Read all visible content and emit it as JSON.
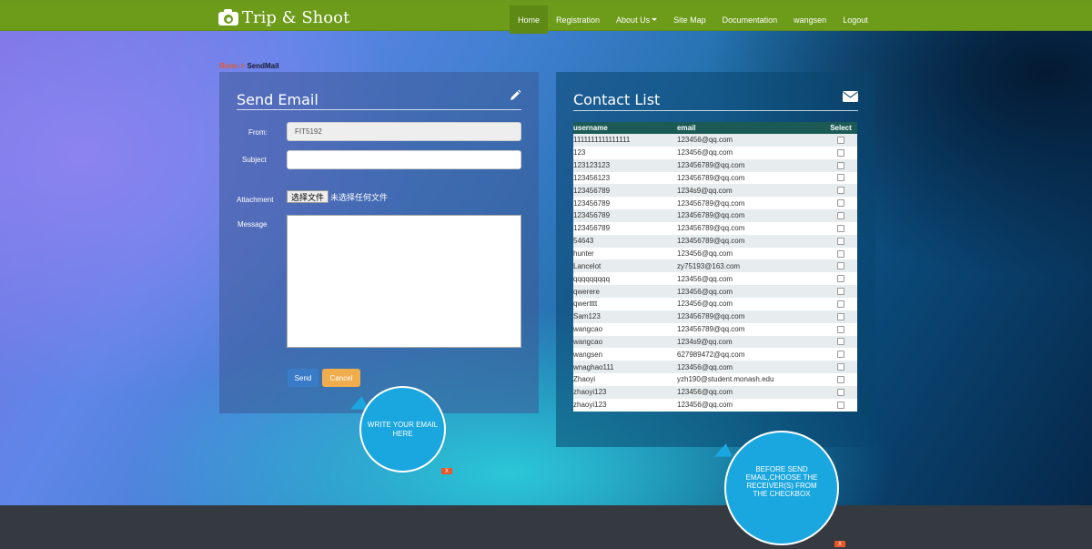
{
  "brand": {
    "title": "Trip & Shoot",
    "icon": "camera-icon"
  },
  "nav": {
    "items": [
      {
        "label": "Home",
        "active": true
      },
      {
        "label": "Registration"
      },
      {
        "label": "About Us",
        "dropdown": true
      },
      {
        "label": "Site Map"
      },
      {
        "label": "Documentation"
      },
      {
        "label": "wangsen"
      },
      {
        "label": "Logout"
      }
    ]
  },
  "breadcrumb": {
    "home": "Root",
    "arrow": "-->",
    "current": "SendMail"
  },
  "send_email": {
    "title": "Send Email",
    "icon": "pencil-icon",
    "from_label": "From:",
    "from_value": "FIT5192",
    "subject_label": "Subject",
    "subject_value": "",
    "attachment_label": "Attachment",
    "file_button": "选择文件",
    "file_status": "未选择任何文件",
    "message_label": "Message",
    "send_button": "Send",
    "cancel_button": "Cancel"
  },
  "contact_list": {
    "title": "Contact List",
    "icon": "envelope-icon",
    "headers": [
      "username",
      "email",
      "Select"
    ],
    "rows": [
      [
        "1111111111111111",
        "123456@qq.com"
      ],
      [
        "123",
        "123456@qq.com"
      ],
      [
        "123123123",
        "123456789@qq.com"
      ],
      [
        "123456123",
        "123456789@qq.com"
      ],
      [
        "123456789",
        "1234s9@qq.com"
      ],
      [
        "123456789",
        "123456789@qq.com"
      ],
      [
        "123456789",
        "123456789@qq.com"
      ],
      [
        "123456789",
        "123456789@qq.com"
      ],
      [
        "54643",
        "123456789@qq.com"
      ],
      [
        "hunter",
        "123456@qq.com"
      ],
      [
        "Lancelot",
        "zy75193@163.com"
      ],
      [
        "qqqqqqqqq",
        "123456@qq.com"
      ],
      [
        "qwerere",
        "123456@qq.com"
      ],
      [
        "qwertttt",
        "123456@qq.com"
      ],
      [
        "Sam123",
        "123456789@qq.com"
      ],
      [
        "wangcao",
        "123456789@qq.com"
      ],
      [
        "wangcao",
        "1234s9@qq.com"
      ],
      [
        "wangsen",
        "627989472@qq.com"
      ],
      [
        "wnaghao111",
        "123456@qq.com"
      ],
      [
        "Zhaoyi",
        "yzh190@student.monash.edu"
      ],
      [
        "zhaoyi123",
        "123456@qq.com"
      ],
      [
        "zhaoyi123",
        "123456@qq.com"
      ]
    ]
  },
  "tooltips": {
    "left": "WRITE YOUR EMAIL HERE",
    "right": "BEFORE SEND EMAIL,CHOOSE THE RECEIVER(S) FROM THE CHECKBOX",
    "close": "X"
  },
  "colors": {
    "navbar": "#6d9b1a",
    "send_button": "#3a7bc8",
    "cancel_button": "#f0ad4e",
    "table_header": "#1c5a55",
    "bubble": "#1aa7e0"
  }
}
